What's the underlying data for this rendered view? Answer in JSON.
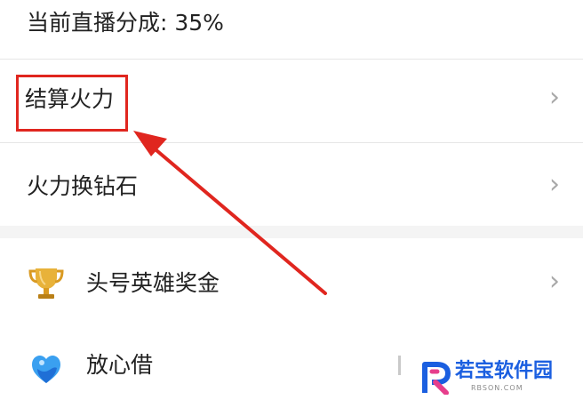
{
  "share": {
    "text": "当前直播分成: 35%"
  },
  "menu": {
    "settle_fire": {
      "label": "结算火力",
      "chevron": "›"
    },
    "fire_to_diamond": {
      "label": "火力换钻石",
      "chevron": "›"
    },
    "top_hero_bonus": {
      "label": "头号英雄奖金",
      "icon": "trophy-icon",
      "chevron": "›"
    },
    "worry_free_loan": {
      "label": "放心借",
      "icon": "heart-shield-icon"
    }
  },
  "annotation": {
    "box_color": "#e0261f",
    "arrow_color": "#e0261f"
  },
  "watermark": {
    "text": "若宝软件园",
    "sub": "RBSON.COM",
    "logo": "r-logo-icon"
  },
  "colors": {
    "text": "#222222",
    "chevron": "#a8a8a8",
    "divider": "#e6e6e6",
    "section_gap": "#f4f4f4",
    "accent_red": "#e0261f",
    "watermark_blue": "#1b5fe0"
  }
}
